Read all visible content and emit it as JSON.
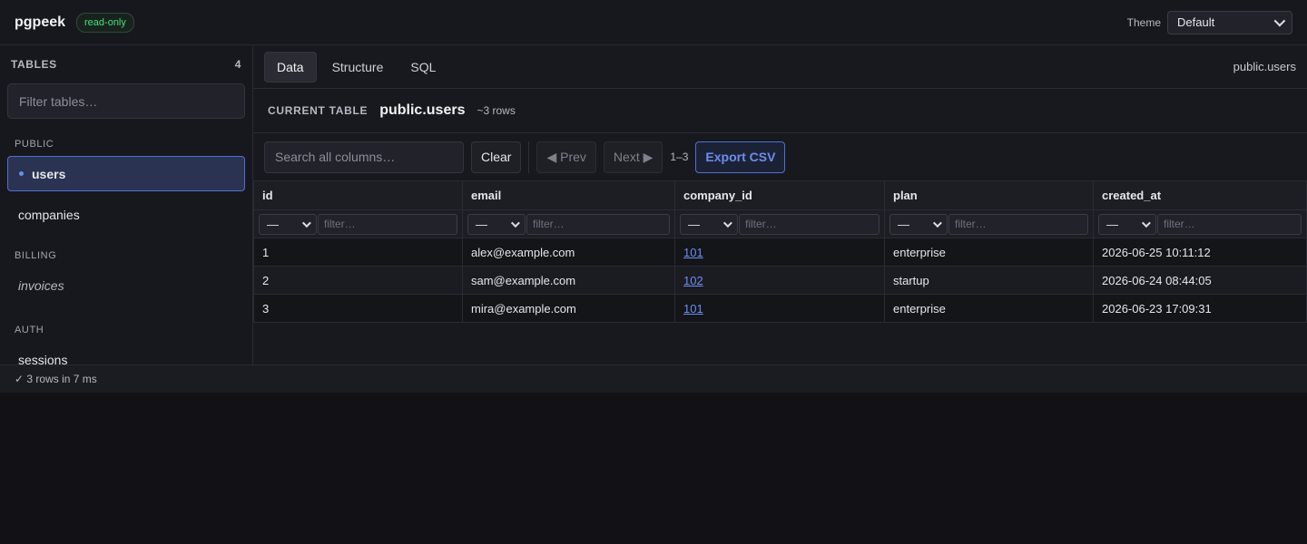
{
  "app": {
    "name": "pgpeek",
    "badge": "read-only"
  },
  "theme": {
    "label": "Theme",
    "value": "Default"
  },
  "sidebar": {
    "title": "TABLES",
    "count": "4",
    "filter_placeholder": "Filter tables…",
    "groups": [
      {
        "label": "PUBLIC",
        "items": [
          "users",
          "companies"
        ]
      },
      {
        "label": "BILLING",
        "items": [
          "invoices"
        ]
      },
      {
        "label": "AUTH",
        "items": [
          "sessions"
        ]
      }
    ],
    "active": "users"
  },
  "tabs": {
    "items": [
      "Data",
      "Structure",
      "SQL"
    ],
    "active": "Data",
    "right_label": "public.users"
  },
  "current": {
    "label": "CURRENT TABLE",
    "name": "public.users",
    "rows": "~3 rows"
  },
  "toolbar": {
    "search_placeholder": "Search all columns…",
    "clear": "Clear",
    "prev": "◀ Prev",
    "next": "Next ▶",
    "range": "1–3",
    "export": "Export CSV"
  },
  "table": {
    "columns": [
      "id",
      "email",
      "company_id",
      "plan",
      "created_at"
    ],
    "filter_op": "—",
    "filter_placeholder": "filter…",
    "rows": [
      [
        "1",
        "alex@example.com",
        "101",
        "enterprise",
        "2026-06-25 10:11:12"
      ],
      [
        "2",
        "sam@example.com",
        "102",
        "startup",
        "2026-06-24 08:44:05"
      ],
      [
        "3",
        "mira@example.com",
        "101",
        "enterprise",
        "2026-06-23 17:09:31"
      ]
    ]
  },
  "status": "✓ 3 rows in 7 ms",
  "colors": {
    "accent": "#6d8cf0",
    "badge_green": "#4ade80",
    "background": "#121216"
  }
}
